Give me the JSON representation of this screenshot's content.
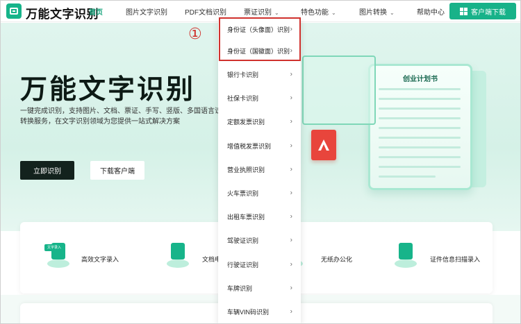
{
  "header": {
    "brand": "万能文字识别",
    "nav": [
      {
        "label": "首页",
        "active": true,
        "chevron": false
      },
      {
        "label": "图片文字识别",
        "active": false,
        "chevron": false
      },
      {
        "label": "PDF文档识别",
        "active": false,
        "chevron": false
      },
      {
        "label": "票证识别",
        "active": false,
        "chevron": true
      },
      {
        "label": "特色功能",
        "active": false,
        "chevron": true
      },
      {
        "label": "图片转换",
        "active": false,
        "chevron": true
      },
      {
        "label": "帮助中心",
        "active": false,
        "chevron": false
      }
    ],
    "download_label": "客户端下载",
    "accent_color": "#18b289"
  },
  "hero": {
    "title": "万能文字识别",
    "description": "一键完成识别，支持图片、文档、票证、手写、竖版、多国语言识别转换服务，在文字识别领域为您提供一站式解决方案",
    "primary_button": "立即识别",
    "secondary_button": "下载客户端",
    "illustration": {
      "doc_title": "创业计划书",
      "pdf_icon": "pdf-icon"
    }
  },
  "features": [
    {
      "label": "高效文字录入",
      "icon": "text-entry-icon",
      "icon_text": "文字录入"
    },
    {
      "label": "文档电",
      "icon": "document-icon",
      "icon_text": ""
    },
    {
      "label": "无纸办公化",
      "icon": "paperless-icon",
      "icon_text": ""
    },
    {
      "label": "证件信息扫描录入",
      "icon": "id-scan-icon",
      "icon_text": ""
    }
  ],
  "dropdown": {
    "items": [
      "身份证（头像面）识别",
      "身份证（国徽面）识别",
      "银行卡识别",
      "社保卡识别",
      "定额发票识别",
      "增值税发票识别",
      "营业执照识别",
      "火车票识别",
      "出租车票识别",
      "驾驶证识别",
      "行驶证识别",
      "车牌识别",
      "车辆VIN码识别"
    ],
    "arrow": "›"
  },
  "annotation": {
    "marker": "①",
    "color": "#d0312d"
  }
}
